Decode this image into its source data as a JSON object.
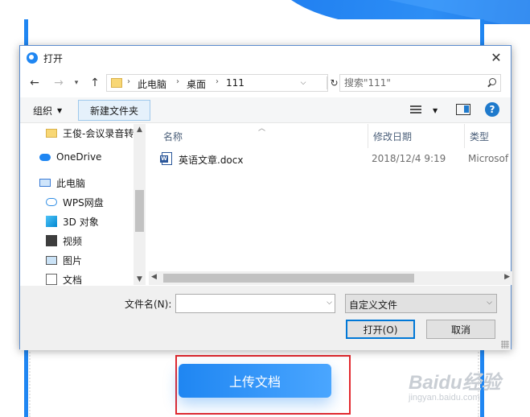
{
  "dialog": {
    "title": "打开",
    "close_glyph": "✕"
  },
  "address": {
    "segments": [
      "此电脑",
      "桌面",
      "111"
    ],
    "search_placeholder": "搜索\"111\""
  },
  "toolbar": {
    "organize_label": "组织",
    "new_folder_label": "新建文件夹"
  },
  "nav_pane": {
    "items": [
      {
        "label": "王俊-会议录音转",
        "icon": "folder-icon"
      },
      {
        "label": "OneDrive",
        "icon": "cloud-icon"
      },
      {
        "label": "此电脑",
        "icon": "computer-icon"
      },
      {
        "label": "WPS网盘",
        "icon": "wps-cloud-icon"
      },
      {
        "label": "3D 对象",
        "icon": "3d-objects-icon"
      },
      {
        "label": "视频",
        "icon": "video-icon"
      },
      {
        "label": "图片",
        "icon": "pictures-icon"
      },
      {
        "label": "文档",
        "icon": "documents-icon"
      }
    ]
  },
  "file_list": {
    "columns": [
      "名称",
      "修改日期",
      "类型"
    ],
    "rows": [
      {
        "name": "英语文章.docx",
        "modified": "2018/12/4 9:19",
        "type": "Microsof",
        "icon": "word-doc-icon"
      }
    ]
  },
  "footer": {
    "filename_label": "文件名(N):",
    "filename_value": "",
    "filetype_value": "自定义文件",
    "open_label": "打开(O)",
    "cancel_label": "取消"
  },
  "page": {
    "upload_button_label": "上传文档",
    "watermark_main": "Baidu经验",
    "watermark_sub": "jingyan.baidu.com"
  },
  "colors": {
    "accent": "#1f86f2",
    "highlight_border": "#e2282e"
  }
}
